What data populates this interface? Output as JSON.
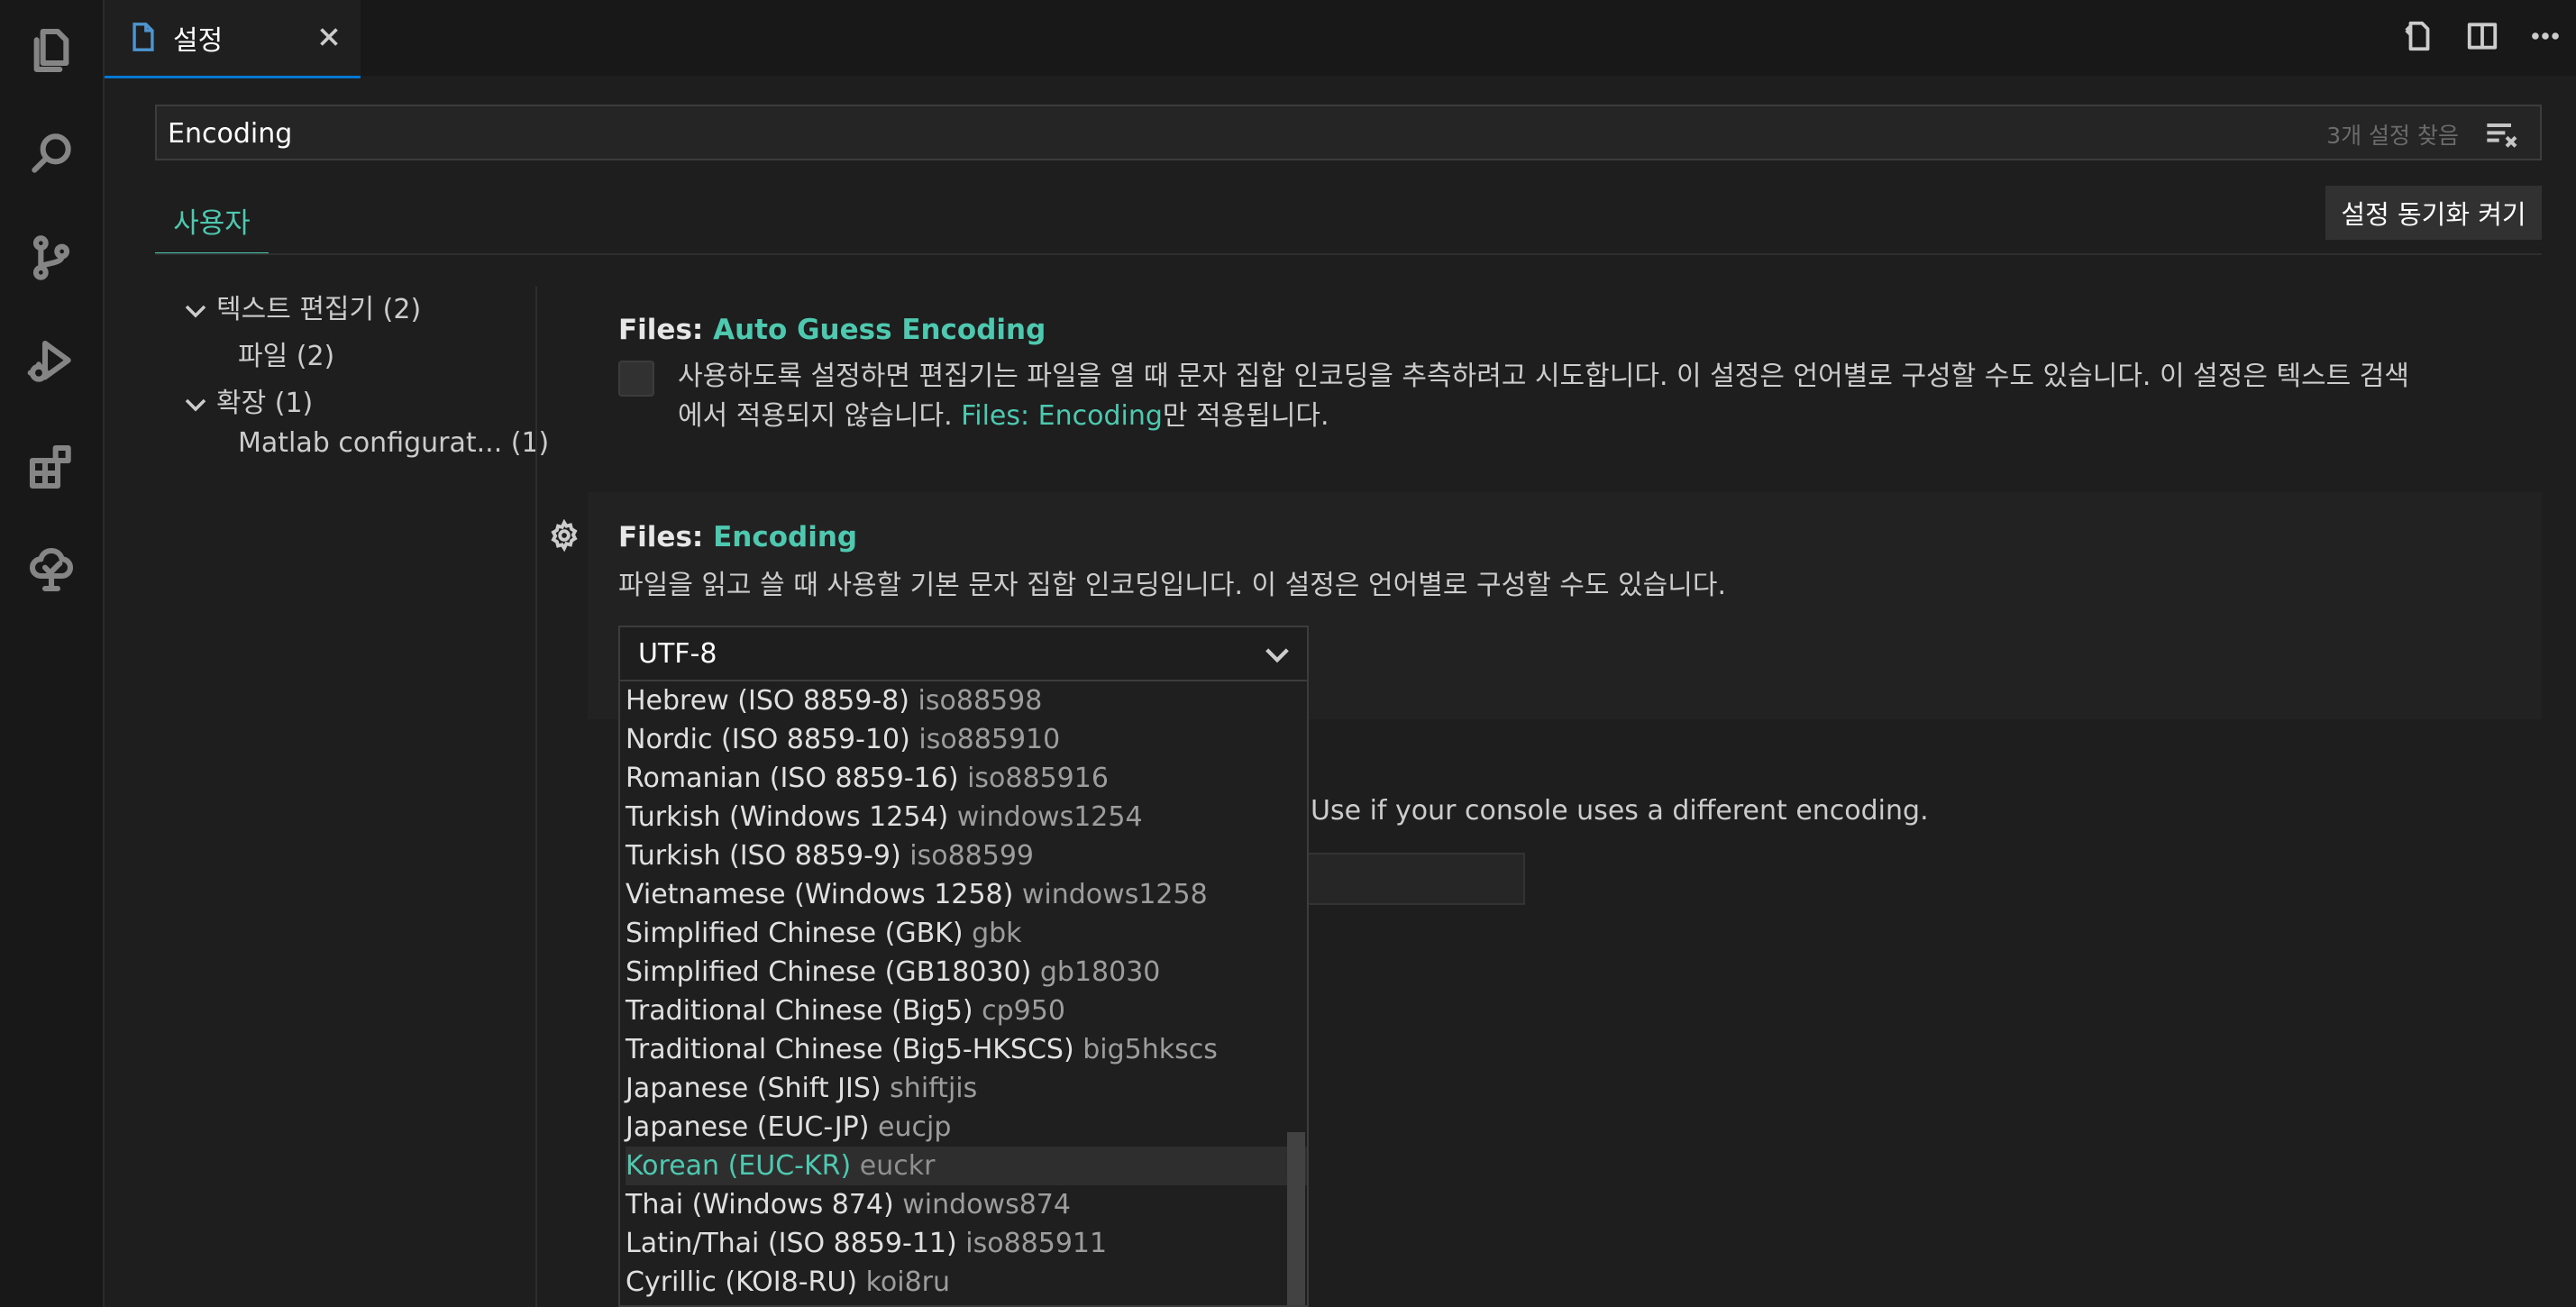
{
  "activity_bar": {
    "icons": [
      "explorer-icon",
      "search-icon",
      "source-control-icon",
      "run-debug-icon",
      "extensions-icon",
      "testing-icon"
    ]
  },
  "editor_tab": {
    "label": "설정"
  },
  "search": {
    "value": "Encoding",
    "result_count": "3개 설정 찾음"
  },
  "scope": {
    "user_tab": "사용자",
    "sync_button": "설정 동기화 켜기"
  },
  "toc": {
    "items": [
      {
        "label": "텍스트 편집기 (2)",
        "expanded": true
      },
      {
        "label": "파일 (2)"
      },
      {
        "label": "확장 (1)",
        "expanded": true
      },
      {
        "label": "Matlab configurat... (1)"
      }
    ]
  },
  "settings": {
    "auto_guess": {
      "category": "Files: ",
      "name": "Auto Guess Encoding",
      "desc_line1": "사용하도록 설정하면 편집기는 파일을 열 때 문자 집합 인코딩을 추측하려고 시도합니다. 이 설정은 언어별로 구성할 수도 있습니다. 이 설정은 텍스트 검색",
      "desc_line2_pre": "에서 적용되지 않습니다. ",
      "desc_link": "Files: Encoding",
      "desc_line2_post": "만 적용됩니다.",
      "checked": false
    },
    "encoding": {
      "category": "Files: ",
      "name": "Encoding",
      "desc": "파일을 읽고 쓸 때 사용할 기본 문자 집합 인코딩입니다. 이 설정은 언어별로 구성할 수도 있습니다.",
      "value": "UTF-8"
    },
    "terminal_desc_visible": "Use if your console uses a different encoding."
  },
  "encoding_options": [
    {
      "label": "Hebrew (ISO 8859-8)",
      "id": "iso88598"
    },
    {
      "label": "Nordic (ISO 8859-10)",
      "id": "iso885910"
    },
    {
      "label": "Romanian (ISO 8859-16)",
      "id": "iso885916"
    },
    {
      "label": "Turkish (Windows 1254)",
      "id": "windows1254"
    },
    {
      "label": "Turkish (ISO 8859-9)",
      "id": "iso88599"
    },
    {
      "label": "Vietnamese (Windows 1258)",
      "id": "windows1258"
    },
    {
      "label": "Simplified Chinese (GBK)",
      "id": "gbk"
    },
    {
      "label": "Simplified Chinese (GB18030)",
      "id": "gb18030"
    },
    {
      "label": "Traditional Chinese (Big5)",
      "id": "cp950"
    },
    {
      "label": "Traditional Chinese (Big5-HKSCS)",
      "id": "big5hkscs"
    },
    {
      "label": "Japanese (Shift JIS)",
      "id": "shiftjis"
    },
    {
      "label": "Japanese (EUC-JP)",
      "id": "eucjp"
    },
    {
      "label": "Korean (EUC-KR)",
      "id": "euckr",
      "selected": true
    },
    {
      "label": "Thai (Windows 874)",
      "id": "windows874"
    },
    {
      "label": "Latin/Thai (ISO 8859-11)",
      "id": "iso885911"
    },
    {
      "label": "Cyrillic (KOI8-RU)",
      "id": "koi8ru"
    }
  ],
  "colors": {
    "accent": "#4ec9b0",
    "tab_active_border": "#0078d4",
    "background": "#1e1e1e"
  }
}
